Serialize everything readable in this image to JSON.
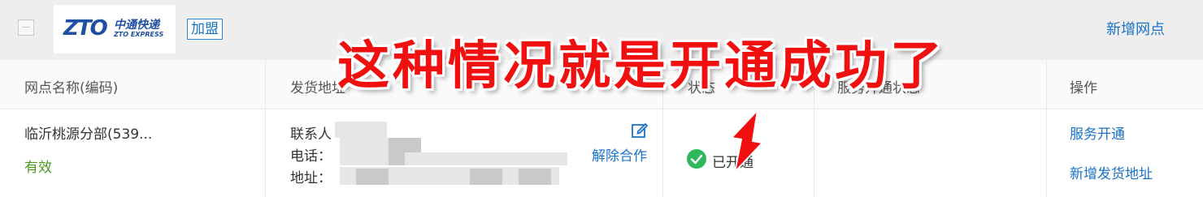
{
  "toolbar": {
    "logo_mark": "ZTO",
    "logo_cn": "中通快递",
    "logo_en": "ZTO EXPRESS",
    "join_label": "加盟",
    "add_site_label": "新增网点"
  },
  "table": {
    "headers": [
      "网点名称(编码)",
      "发货地址",
      "状态",
      "服务开通状态",
      "操作"
    ],
    "row": {
      "site_name": "临沂桃源分部(539...",
      "site_status": "有效",
      "contact_label": "联系人",
      "phone_label": "电话：",
      "address_label": "地址：",
      "cancel_coop": "解除合作",
      "status_text": "已开通",
      "action_service": "服务开通",
      "action_add_address": "新增发货地址"
    }
  },
  "annotation": {
    "caption": "这种情况就是开通成功了"
  },
  "colors": {
    "link": "#1a73c9",
    "valid": "#4a9a1f",
    "success": "#2eb85c",
    "annotation": "#f01010"
  }
}
